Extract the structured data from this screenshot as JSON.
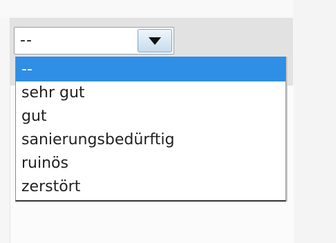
{
  "select": {
    "value": "--",
    "arrow_icon": "triangle-down-icon"
  },
  "dropdown": {
    "selected_index": 0,
    "options": [
      "--",
      "sehr gut",
      "gut",
      "sanierungsbedürftig",
      "ruinös",
      "zerstört"
    ]
  },
  "colors": {
    "selected_bg": "#2f8ee5",
    "header_bg": "#e2e2e2"
  }
}
